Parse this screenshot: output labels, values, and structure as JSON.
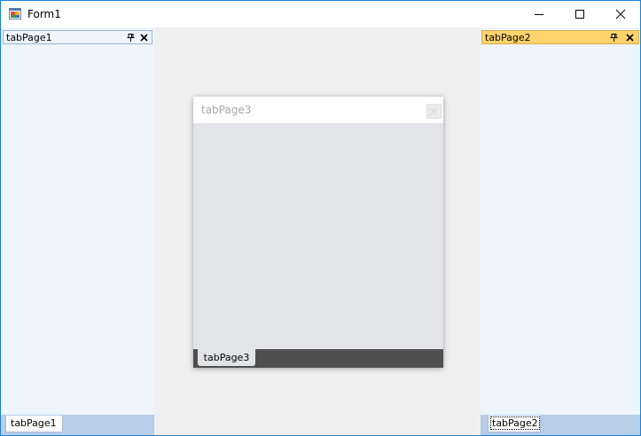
{
  "window": {
    "title": "Form1"
  },
  "left_panel": {
    "title": "tabPage1",
    "bottom_tab": "tabPage1"
  },
  "right_panel": {
    "title": "tabPage2",
    "bottom_tab": "tabPage2"
  },
  "floating_window": {
    "title": "tabPage3",
    "tab_label": "tabPage3"
  },
  "icons": {
    "app": "form-app-icon",
    "minimize": "minimize-icon",
    "maximize": "maximize-icon",
    "close": "close-icon",
    "pin": "pin-icon"
  },
  "colors": {
    "window_border": "#1883d7",
    "panel_bg": "#eef5fd",
    "active_header": "#ffd36b",
    "bottom_strip": "#b8cde8",
    "float_tabstrip": "#4f4f4f"
  }
}
